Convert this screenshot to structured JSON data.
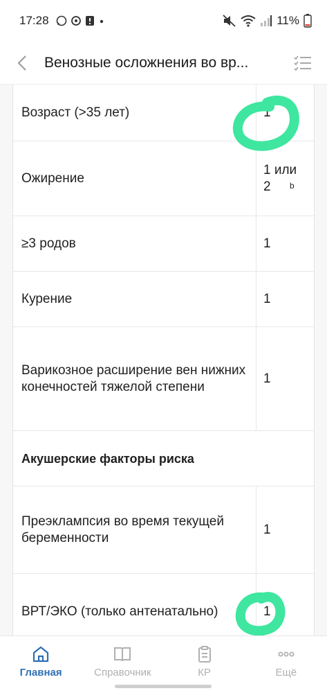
{
  "status_bar": {
    "time": "17:28",
    "battery": "11%"
  },
  "header": {
    "title": "Венозные осложнения во вр..."
  },
  "table": {
    "rows": [
      {
        "label": "Возраст (>35 лет)",
        "value": "1"
      },
      {
        "label": "Ожирение",
        "value": "1 или 2",
        "value_sup": "b"
      },
      {
        "label": "≥3 родов",
        "value": "1"
      },
      {
        "label": "Курение",
        "value": "1"
      },
      {
        "label": "Варикозное расширение вен нижних конечностей тяжелой степени",
        "value": "1"
      },
      {
        "section": "Акушерские факторы риска"
      },
      {
        "label": "Преэклампсия во время текущей беременности",
        "value": "1"
      },
      {
        "label": "ВРТ/ЭКО (только антенатально)",
        "value": "1"
      }
    ]
  },
  "bottom_nav": {
    "items": [
      {
        "label": "Главная",
        "icon": "home-icon",
        "active": true
      },
      {
        "label": "Справочник",
        "icon": "book-icon",
        "active": false
      },
      {
        "label": "КР",
        "icon": "clipboard-icon",
        "active": false
      },
      {
        "label": "Ещё",
        "icon": "more-dots-icon",
        "active": false
      }
    ]
  },
  "colors": {
    "accent": "#2f6fb3",
    "marker": "#3ee6a0"
  }
}
